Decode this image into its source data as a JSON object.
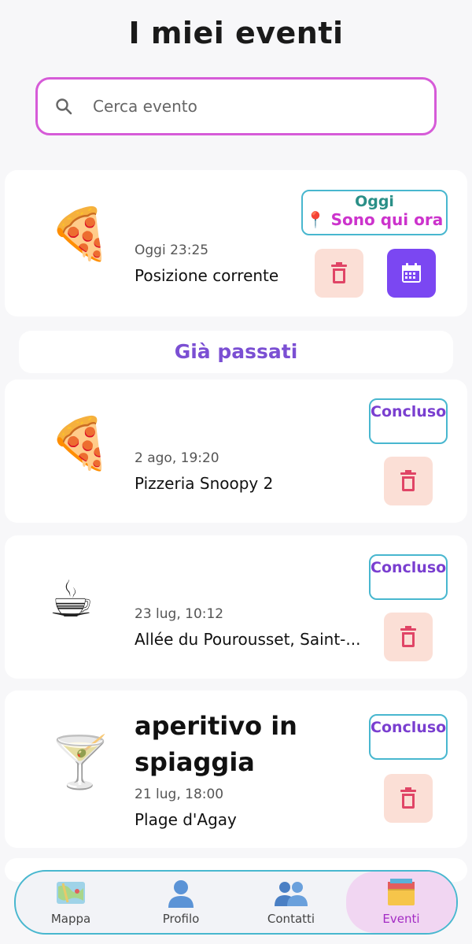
{
  "page": {
    "title": "I miei eventi"
  },
  "search": {
    "placeholder": "Cerca evento",
    "value": ""
  },
  "current_event": {
    "emoji": "🍕",
    "date": "Oggi 23:25",
    "place": "Posizione corrente",
    "badge_day": "Oggi",
    "badge_status": "📍 Sono qui ora"
  },
  "past_section": {
    "label": "Già passati"
  },
  "past_events": [
    {
      "emoji": "🍕",
      "title": "",
      "date": "2 ago, 19:20",
      "place": "Pizzeria Snoopy 2",
      "status": "Concluso"
    },
    {
      "emoji": "☕",
      "title": "",
      "date": "23 lug, 10:12",
      "place": "Allée du Pourousset, Saint-...",
      "status": "Concluso"
    },
    {
      "emoji": "🍸",
      "title": "aperitivo in spiaggia",
      "date": "21 lug, 18:00",
      "place": "Plage d'Agay",
      "status": "Concluso"
    }
  ],
  "nav": {
    "items": [
      {
        "label": "Mappa",
        "icon": "map-icon"
      },
      {
        "label": "Profilo",
        "icon": "profile-icon"
      },
      {
        "label": "Contatti",
        "icon": "contacts-icon"
      },
      {
        "label": "Eventi",
        "icon": "events-icon"
      }
    ],
    "active": "Eventi"
  },
  "colors": {
    "accent": "#7b47f2",
    "search_border": "#d65bd8",
    "badge_border": "#48b7cf",
    "delete_bg": "#fbdfd6"
  }
}
